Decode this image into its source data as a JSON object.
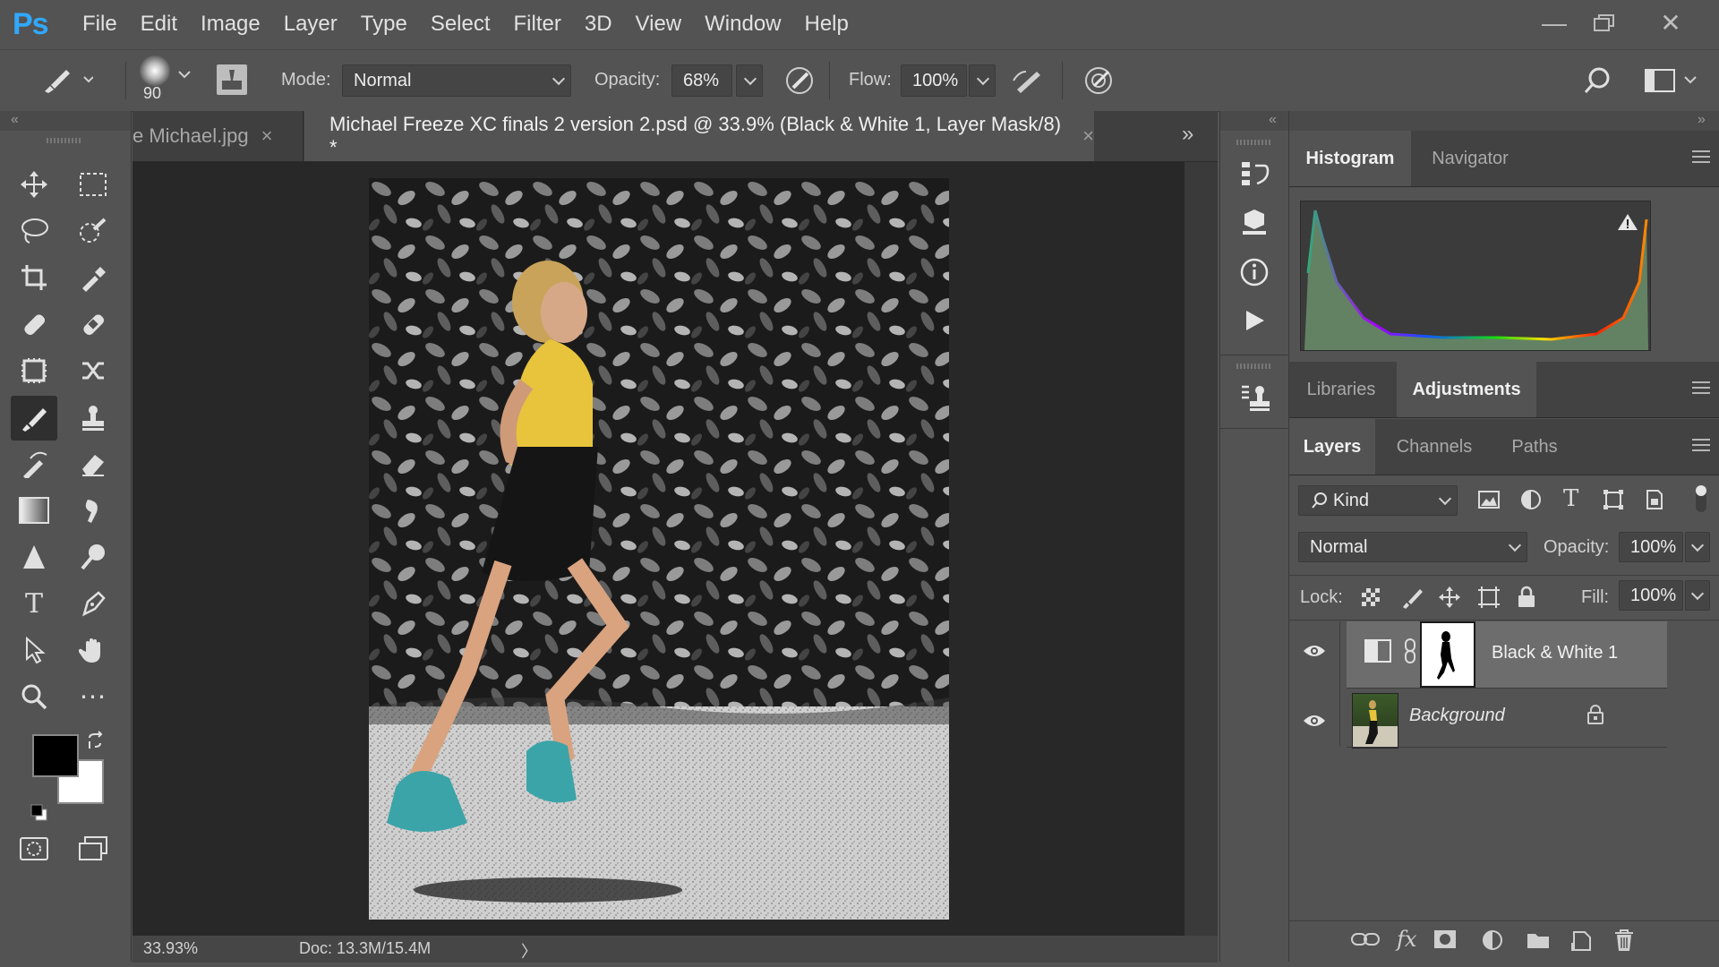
{
  "app": {
    "logo": "Ps"
  },
  "menu": [
    "File",
    "Edit",
    "Image",
    "Layer",
    "Type",
    "Select",
    "Filter",
    "3D",
    "View",
    "Window",
    "Help"
  ],
  "options": {
    "brush_size": "90",
    "mode_label": "Mode:",
    "mode_value": "Normal",
    "opacity_label": "Opacity:",
    "opacity_value": "68%",
    "flow_label": "Flow:",
    "flow_value": "100%"
  },
  "tabs": [
    {
      "label": "e Michael.jpg",
      "close": "×"
    },
    {
      "label": "Michael Freeze XC finals 2 version 2.psd @ 33.9% (Black & White 1, Layer Mask/8) *",
      "close": "×"
    }
  ],
  "status": {
    "zoom": "33.93%",
    "doc": "Doc: 13.3M/15.4M",
    "arrow": "〉"
  },
  "panels": {
    "top_tabs": [
      "Histogram",
      "Navigator"
    ],
    "mid_tabs": [
      "Libraries",
      "Adjustments"
    ],
    "layer_tabs": [
      "Layers",
      "Channels",
      "Paths"
    ],
    "filter_kind": "Kind",
    "blend_mode": "Normal",
    "opacity_label": "Opacity:",
    "opacity_value": "100%",
    "lock_label": "Lock:",
    "fill_label": "Fill:",
    "fill_value": "100%"
  },
  "layers": [
    {
      "name": "Black & White 1",
      "selected": true
    },
    {
      "name": "Background",
      "selected": false,
      "locked": true
    }
  ],
  "colors": {
    "accent": "#31a8ff",
    "foreground": "#000000",
    "background": "#ffffff"
  }
}
